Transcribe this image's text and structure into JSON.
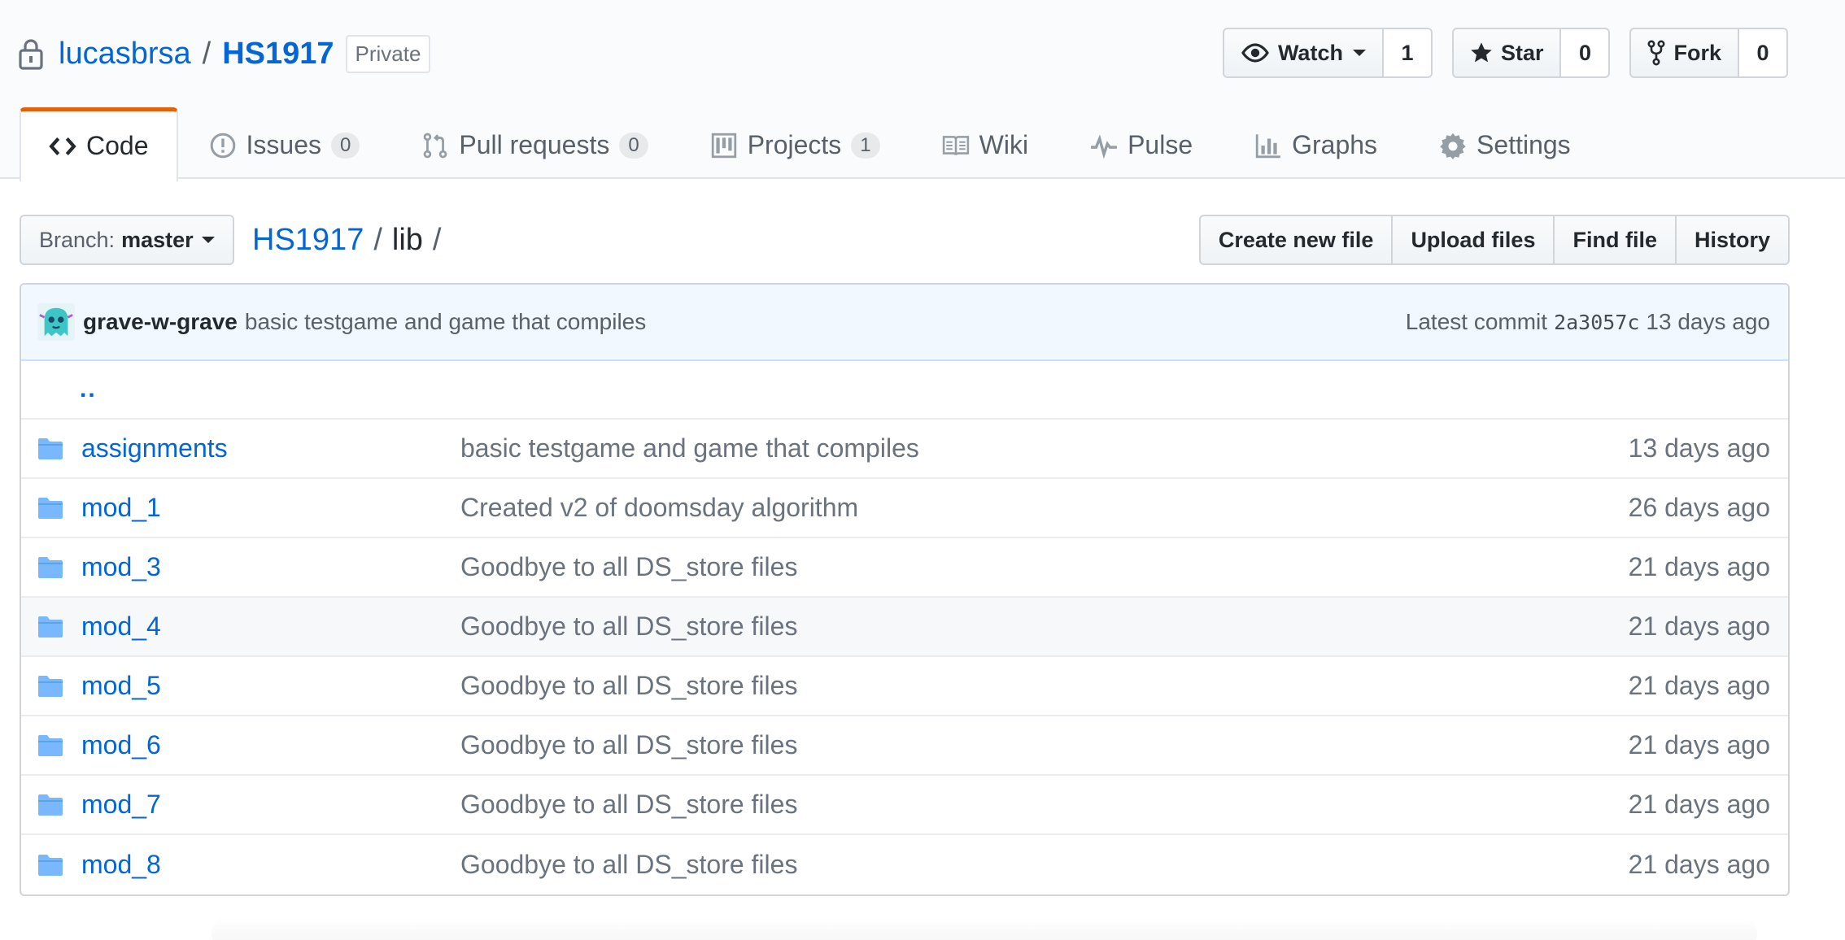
{
  "repo": {
    "owner": "lucasbrsa",
    "name": "HS1917",
    "visibility": "Private"
  },
  "actions": {
    "watch": {
      "label": "Watch",
      "count": "1"
    },
    "star": {
      "label": "Star",
      "count": "0"
    },
    "fork": {
      "label": "Fork",
      "count": "0"
    }
  },
  "nav": {
    "code": {
      "label": "Code"
    },
    "issues": {
      "label": "Issues",
      "count": "0"
    },
    "pulls": {
      "label": "Pull requests",
      "count": "0"
    },
    "projects": {
      "label": "Projects",
      "count": "1"
    },
    "wiki": {
      "label": "Wiki"
    },
    "pulse": {
      "label": "Pulse"
    },
    "graphs": {
      "label": "Graphs"
    },
    "settings": {
      "label": "Settings"
    }
  },
  "file_nav": {
    "branch_prefix": "Branch:",
    "branch": "master",
    "breadcrumb_repo": "HS1917",
    "breadcrumb_dir": "lib",
    "separator": "/",
    "buttons": {
      "create": "Create new file",
      "upload": "Upload files",
      "find": "Find file",
      "history": "History"
    }
  },
  "commit": {
    "author": "grave-w-grave",
    "message": "basic testgame and game that compiles",
    "latest_label": "Latest commit",
    "sha": "2a3057c",
    "age": "13 days ago"
  },
  "parent_dir": "..",
  "files": [
    {
      "name": "assignments",
      "message": "basic testgame and game that compiles",
      "age": "13 days ago"
    },
    {
      "name": "mod_1",
      "message": "Created v2 of doomsday algorithm",
      "age": "26 days ago"
    },
    {
      "name": "mod_3",
      "message": "Goodbye to all DS_store files",
      "age": "21 days ago"
    },
    {
      "name": "mod_4",
      "message": "Goodbye to all DS_store files",
      "age": "21 days ago"
    },
    {
      "name": "mod_5",
      "message": "Goodbye to all DS_store files",
      "age": "21 days ago"
    },
    {
      "name": "mod_6",
      "message": "Goodbye to all DS_store files",
      "age": "21 days ago"
    },
    {
      "name": "mod_7",
      "message": "Goodbye to all DS_store files",
      "age": "21 days ago"
    },
    {
      "name": "mod_8",
      "message": "Goodbye to all DS_store files",
      "age": "21 days ago"
    }
  ],
  "colors": {
    "link": "#0366d6",
    "selected_tab_accent": "#e36209",
    "commit_tease_bg": "#f1f8ff",
    "folder_icon": "#79b8ff"
  }
}
